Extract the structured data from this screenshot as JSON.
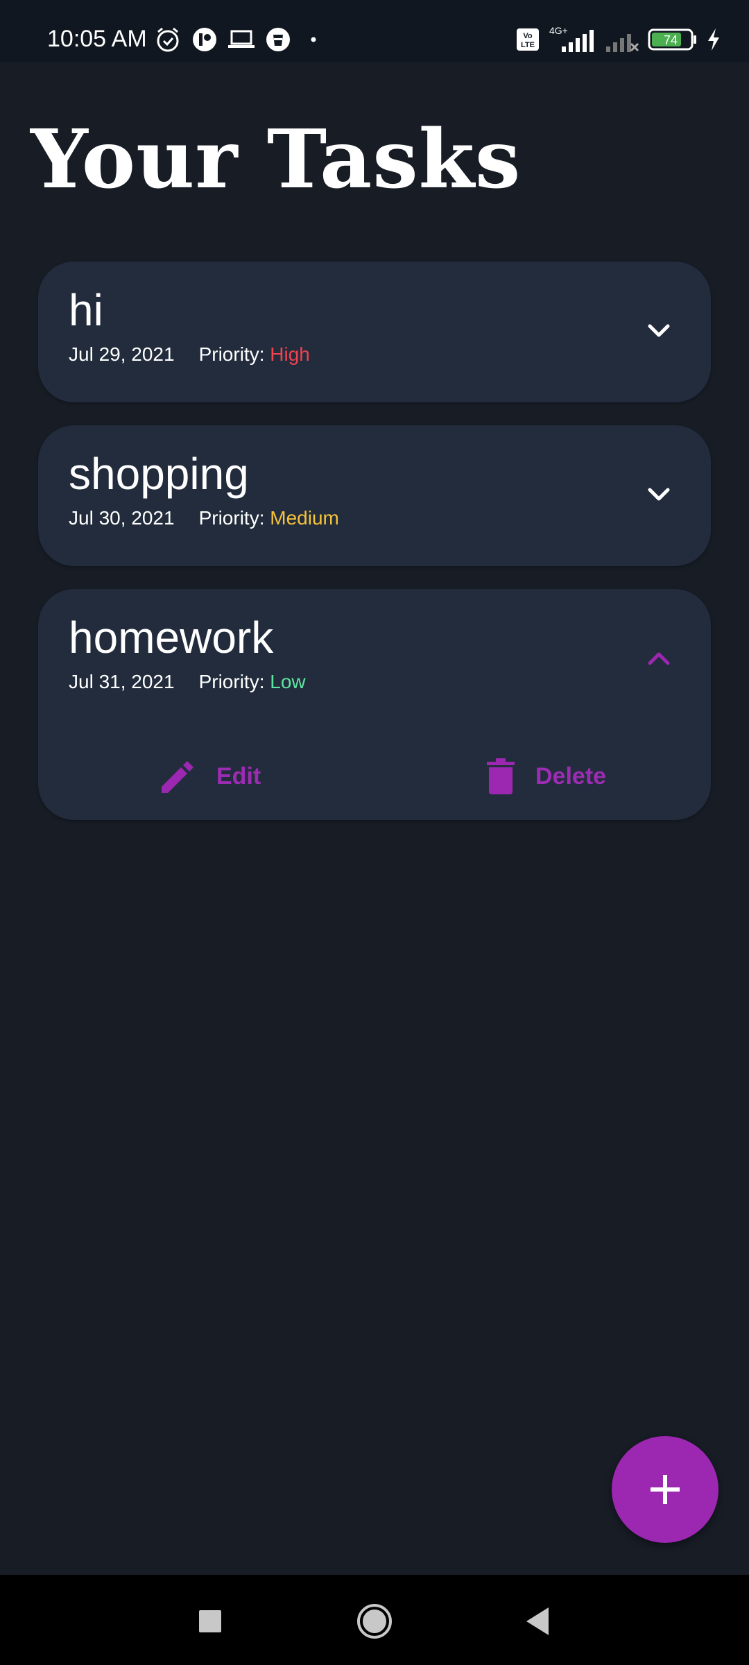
{
  "status_bar": {
    "time": "10:05 AM",
    "battery": "74",
    "network": "4G+",
    "volte": "Vo LTE",
    "icons_left": [
      "alarm-icon",
      "app-notification-icon",
      "laptop-icon",
      "cup-icon",
      "dot-icon"
    ],
    "icons_right": [
      "volte-icon",
      "signal-icon",
      "no-signal-icon",
      "battery-icon",
      "charging-icon"
    ]
  },
  "page": {
    "title": "Your Tasks"
  },
  "tasks": [
    {
      "title": "hi",
      "date": "Jul 29, 2021",
      "priority_label": "Priority:",
      "priority": "High",
      "priority_color": "#f0434f",
      "expanded": false
    },
    {
      "title": "shopping",
      "date": "Jul 30, 2021",
      "priority_label": "Priority:",
      "priority": "Medium",
      "priority_color": "#f5c33b",
      "expanded": false
    },
    {
      "title": "homework",
      "date": "Jul 31, 2021",
      "priority_label": "Priority:",
      "priority": "Low",
      "priority_color": "#5fe3a1",
      "expanded": true,
      "actions": {
        "edit_label": "Edit",
        "delete_label": "Delete"
      }
    }
  ],
  "colors": {
    "background": "#171c25",
    "card": "#222c3c",
    "accent": "#9c27b0"
  },
  "fab": {
    "icon": "plus-icon"
  },
  "nav": {
    "icons": [
      "recent-apps-icon",
      "home-icon",
      "back-icon"
    ]
  }
}
